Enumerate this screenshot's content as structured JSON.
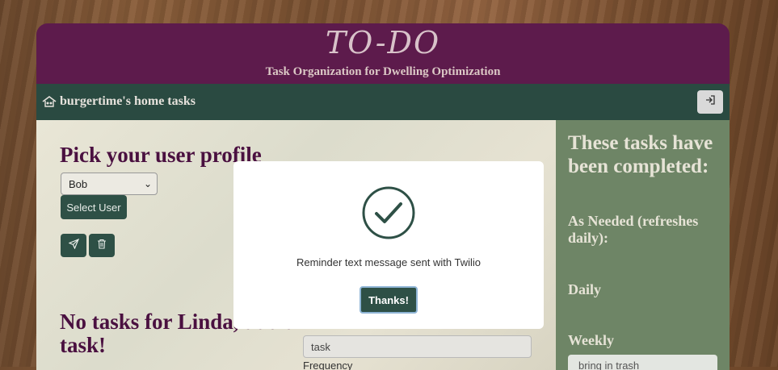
{
  "header": {
    "title": "TO-DO",
    "subtitle": "Task Organization for Dwelling Optimization"
  },
  "navbar": {
    "brand_icon": "house-icon",
    "brand_text": "burgertime's home tasks",
    "logout_icon": "sign-in-icon"
  },
  "left": {
    "profile_heading": "Pick your user profile",
    "user_select_value": "Bob",
    "select_user_label": "Select User",
    "send_icon": "send-icon",
    "trash_icon": "trash-icon",
    "no_tasks_heading": "No tasks for Linda, add a task!",
    "task_input_placeholder": "task",
    "frequency_label": "Frequency"
  },
  "right": {
    "completed_heading": "These tasks have been completed:",
    "as_needed_label": "As Needed (refreshes daily):",
    "daily_label": "Daily",
    "weekly_label": "Weekly",
    "weekly_items": [
      "bring in trash"
    ]
  },
  "modal": {
    "icon": "check-circle-icon",
    "message": "Reminder text message sent with Twilio",
    "button_label": "Thanks!"
  },
  "colors": {
    "header_bg": "#5d1b4c",
    "navbar_bg": "#2a4a41",
    "accent_green": "#2e5046",
    "heading_purple": "#4a1040"
  }
}
